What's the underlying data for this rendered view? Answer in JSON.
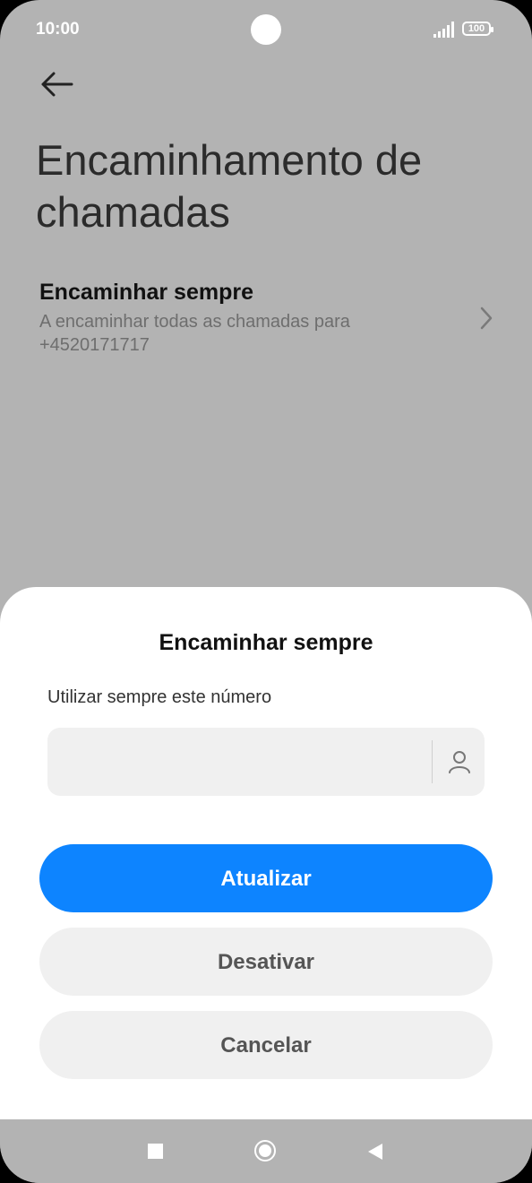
{
  "status_bar": {
    "time": "10:00",
    "battery": "100",
    "signal_icon": "signal-icon",
    "camera_icon": "camera-cutout"
  },
  "header": {
    "back_icon": "arrow-left-icon",
    "title": "Encaminhamento de chamadas"
  },
  "setting": {
    "title": "Encaminhar sempre",
    "subtitle": "A encaminhar todas as chamadas para +4520171717",
    "chevron_icon": "chevron-right-icon"
  },
  "dialog": {
    "title": "Encaminhar sempre",
    "field_label": "Utilizar sempre este número",
    "field_value": "",
    "contact_icon": "person-icon",
    "buttons": {
      "update": "Atualizar",
      "disable": "Desativar",
      "cancel": "Cancelar"
    },
    "colors": {
      "primary": "#0d84ff",
      "secondary_bg": "#f0f0f0"
    }
  },
  "nav": {
    "recents_icon": "square-icon",
    "home_icon": "circle-home-icon",
    "back_icon": "triangle-back-icon"
  }
}
